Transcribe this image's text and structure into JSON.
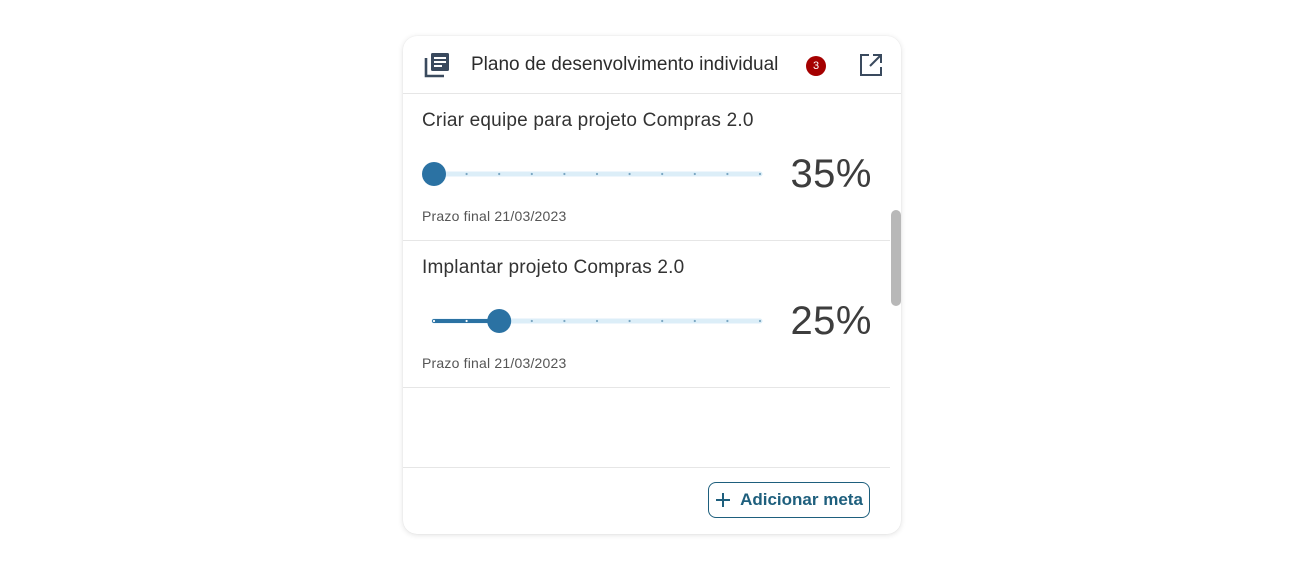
{
  "header": {
    "title": "Plano de desenvolvimento individual",
    "badge_count": "3",
    "icon": "book-stack-icon",
    "action_icon": "open-in-new-icon"
  },
  "goals": [
    {
      "title": "Criar equipe para projeto Compras 2.0",
      "percent_label": "35%",
      "slider_value": 0,
      "deadline": "Prazo final 21/03/2023"
    },
    {
      "title": "Implantar projeto Compras 2.0",
      "percent_label": "25%",
      "slider_value": 0.2,
      "deadline": "Prazo final 21/03/2023"
    }
  ],
  "footer": {
    "add_label": "Adicionar meta",
    "add_icon": "plus-icon"
  },
  "colors": {
    "accent": "#2b72a3",
    "track": "#dceef8",
    "badge": "#a50000",
    "button_text": "#1e5f7d"
  }
}
